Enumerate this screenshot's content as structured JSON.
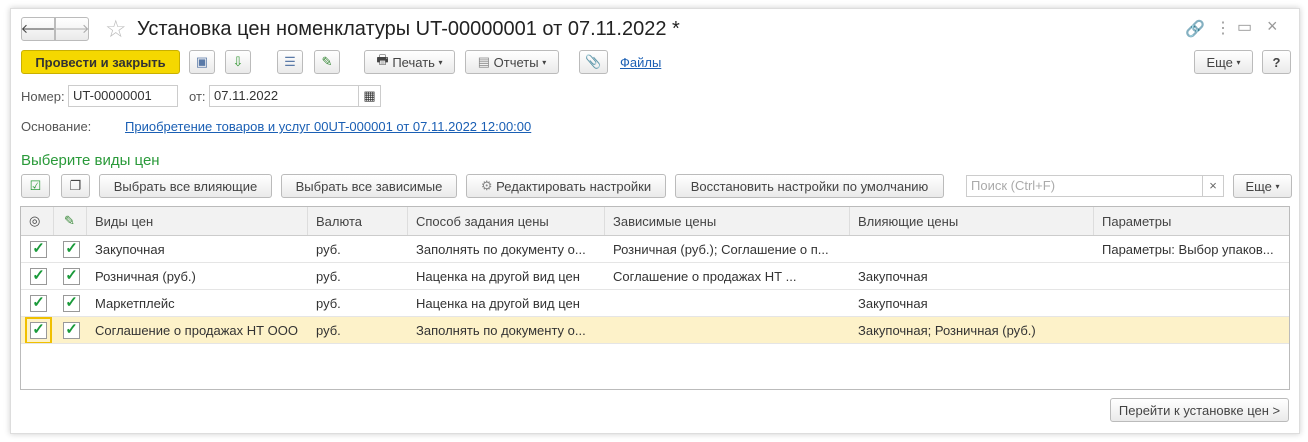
{
  "title": "Установка цен номенклатуры UT-00000001 от 07.11.2022 *",
  "toolbar": {
    "post_close": "Провести и закрыть",
    "print": "Печать",
    "reports": "Отчеты",
    "files": "Файлы",
    "more": "Еще",
    "help": "?"
  },
  "form": {
    "number_label": "Номер:",
    "number": "UT-00000001",
    "date_label": "от:",
    "date": "07.11.2022",
    "basis_label": "Основание:",
    "basis": "Приобретение товаров и услуг 00UT-000001 от 07.11.2022 12:00:00"
  },
  "section_title": "Выберите виды цен",
  "grid_toolbar": {
    "select_influencing": "Выбрать все влияющие",
    "select_dependent": "Выбрать все зависимые",
    "edit_settings": "Редактировать настройки",
    "restore_defaults": "Восстановить настройки по умолчанию",
    "search_placeholder": "Поиск (Ctrl+F)",
    "clear": "×",
    "more": "Еще"
  },
  "columns": [
    "Виды цен",
    "Валюта",
    "Способ задания цены",
    "Зависимые цены",
    "Влияющие цены",
    "Параметры"
  ],
  "rows": [
    {
      "name": "Закупочная",
      "currency": "руб.",
      "method": "Заполнять по документу о...",
      "dependent": "Розничная (руб.); Соглашение о п...",
      "influencing": "",
      "params": "Параметры: Выбор упаков...",
      "visible": true,
      "edit": true
    },
    {
      "name": "Розничная (руб.)",
      "currency": "руб.",
      "method": "Наценка на другой вид цен",
      "dependent": "Соглашение о продажах НТ ...",
      "influencing": "Закупочная",
      "params": "",
      "visible": true,
      "edit": true
    },
    {
      "name": "Маркетплейс",
      "currency": "руб.",
      "method": "Наценка на другой вид цен",
      "dependent": "",
      "influencing": "Закупочная",
      "params": "",
      "visible": true,
      "edit": true
    },
    {
      "name": "Соглашение о продажах НТ ООО",
      "currency": "руб.",
      "method": "Заполнять по документу о...",
      "dependent": "",
      "influencing": "Закупочная; Розничная (руб.)",
      "params": "",
      "visible": true,
      "edit": true
    }
  ],
  "footer": {
    "go_to_prices": "Перейти к установке цен >"
  }
}
